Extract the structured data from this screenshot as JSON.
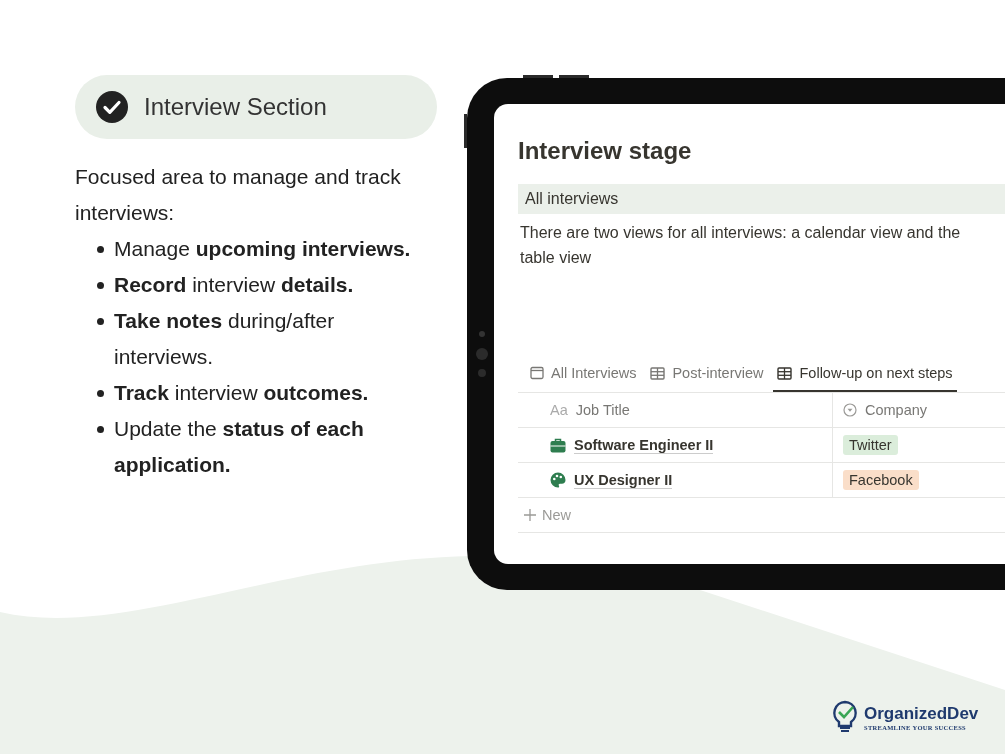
{
  "section_header": {
    "title": "Interview Section"
  },
  "intro": "Focused area to manage and track interviews:",
  "bullets": [
    "Manage **upcoming interviews.**",
    "**Record** interview **details.**",
    "**Take notes** during/after interviews.",
    "**Track** interview **outcomes.**",
    "Update the **status of each application.**"
  ],
  "tablet": {
    "page_title": "Interview stage",
    "callout": "All interviews",
    "description": "There are two views for all interviews: a calendar view and the table view",
    "tabs": [
      {
        "label": "All Interviews",
        "kind": "calendar",
        "selected": false
      },
      {
        "label": "Post-interview",
        "kind": "table",
        "selected": false
      },
      {
        "label": "Follow-up on next steps",
        "kind": "table",
        "selected": true
      }
    ],
    "table": {
      "columns": [
        {
          "label": "Job Title",
          "kind": "text",
          "type_label": "Aa"
        },
        {
          "label": "Company",
          "kind": "select"
        }
      ],
      "rows": [
        {
          "title": "Software Engineer II",
          "kind": "briefcase",
          "company": {
            "label": "Twitter",
            "color": "#dbeddb"
          }
        },
        {
          "title": "UX Designer II",
          "kind": "palette",
          "company": {
            "label": "Facebook",
            "color": "#fadec9"
          }
        }
      ],
      "new_row": "New"
    }
  },
  "logo": {
    "brand": "OrganizedDev",
    "tagline": "STREAMLINE YOUR SUCCESS"
  }
}
